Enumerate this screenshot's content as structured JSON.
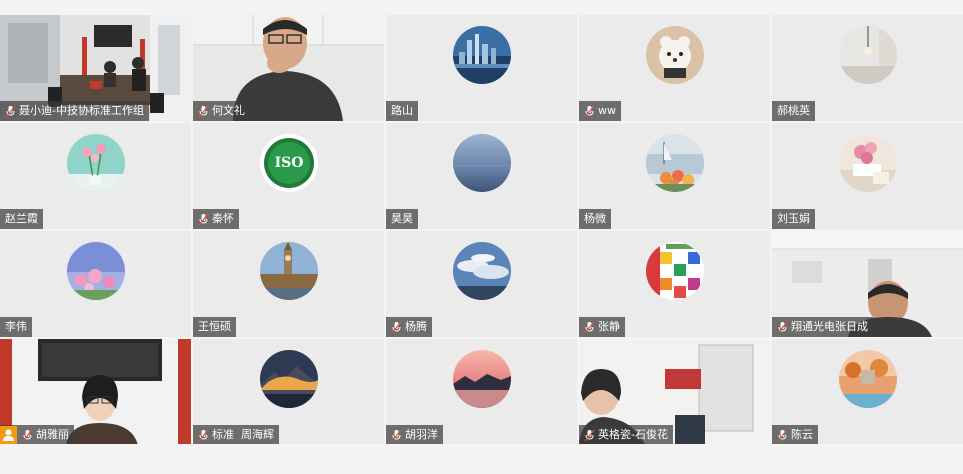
{
  "participants": [
    {
      "name": "聂小迪-中技协标准工作组",
      "muted": true,
      "video": "office"
    },
    {
      "name": "何文礼",
      "muted": true,
      "video": "man"
    },
    {
      "name": "路山",
      "muted": false,
      "avatar": "city"
    },
    {
      "name": "ww",
      "muted": true,
      "avatar": "dog"
    },
    {
      "name": "郝桃英",
      "muted": false,
      "avatar": "room"
    },
    {
      "name": "赵兰霞",
      "muted": false,
      "avatar": "flowers-teal"
    },
    {
      "name": "秦怀",
      "muted": true,
      "avatar": "iso"
    },
    {
      "name": "昊昊",
      "muted": false,
      "avatar": "sea"
    },
    {
      "name": "杨微",
      "muted": false,
      "avatar": "tulips"
    },
    {
      "name": "刘玉娟",
      "muted": false,
      "avatar": "pink-flowers"
    },
    {
      "name": "李伟",
      "muted": false,
      "avatar": "pink-sky"
    },
    {
      "name": "王恒硕",
      "muted": false,
      "avatar": "bigben"
    },
    {
      "name": "杨腾",
      "muted": true,
      "avatar": "clouds"
    },
    {
      "name": "张静",
      "muted": true,
      "avatar": "flags"
    },
    {
      "name": "翔通光电张日成",
      "muted": true,
      "video": "man2"
    },
    {
      "name": "胡雅丽",
      "muted": true,
      "host": true,
      "video": "woman"
    },
    {
      "name": "标准  周海辉",
      "muted": true,
      "avatar": "mountain"
    },
    {
      "name": "胡羽洋",
      "muted": true,
      "avatar": "sunset"
    },
    {
      "name": "英格瓷-石俊花",
      "muted": true,
      "video": "woman2"
    },
    {
      "name": "陈云",
      "muted": true,
      "avatar": "autumn"
    }
  ],
  "avatar_art": {
    "iso_text": "ISO"
  }
}
